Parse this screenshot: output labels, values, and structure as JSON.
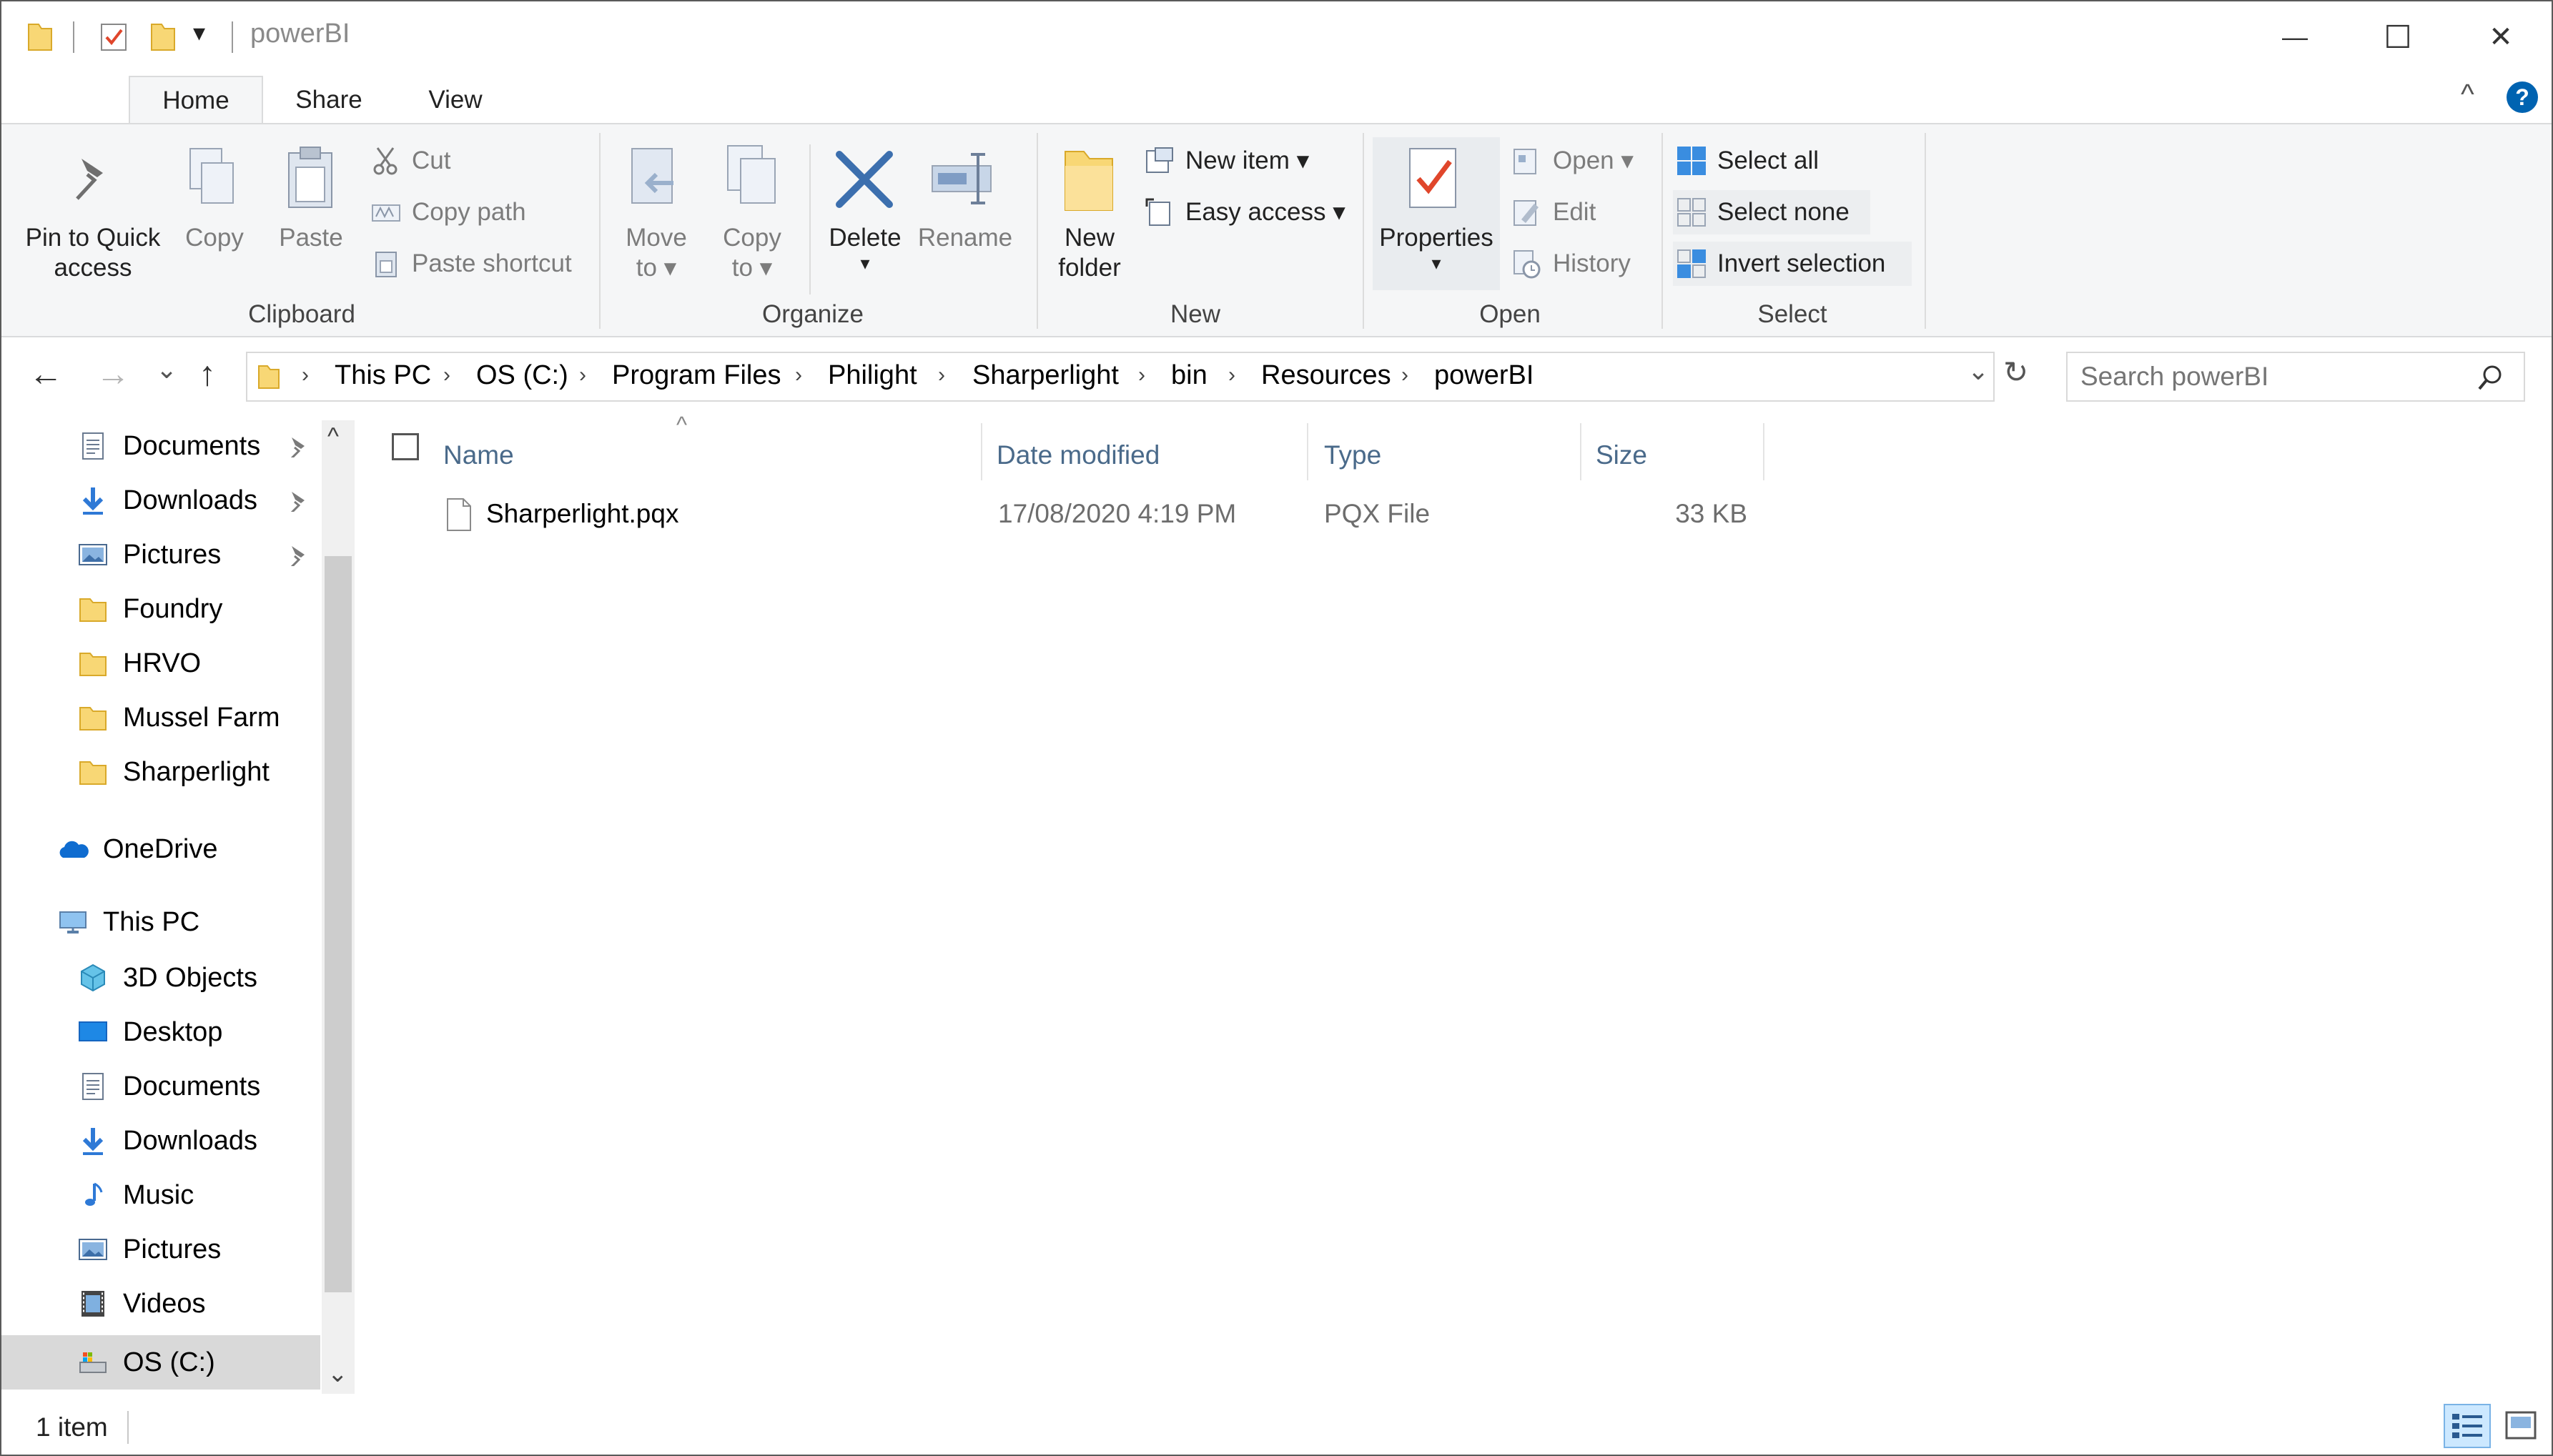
{
  "window": {
    "title": "powerBI",
    "minimize_glyph": "—",
    "maximize_glyph": "☐",
    "close_glyph": "✕"
  },
  "qat": {
    "customize_glyph": "▾"
  },
  "ribbon": {
    "tabs": [
      {
        "label": "Home",
        "active": true
      },
      {
        "label": "Share",
        "active": false
      },
      {
        "label": "View",
        "active": false
      }
    ],
    "collapse_glyph": "^",
    "help_glyph": "?",
    "clipboard": {
      "group_label": "Clipboard",
      "pin_label_1": "Pin to Quick",
      "pin_label_2": "access",
      "copy_label": "Copy",
      "paste_label": "Paste",
      "cut_label": "Cut",
      "copy_path_label": "Copy path",
      "paste_shortcut_label": "Paste shortcut"
    },
    "organize": {
      "group_label": "Organize",
      "move_to_1": "Move",
      "move_to_2": "to ▾",
      "copy_to_1": "Copy",
      "copy_to_2": "to ▾",
      "delete_label": "Delete",
      "delete_arrow": "▾",
      "rename_label": "Rename"
    },
    "new": {
      "group_label": "New",
      "new_folder_1": "New",
      "new_folder_2": "folder",
      "new_item_label": "New item ▾",
      "easy_access_label": "Easy access ▾"
    },
    "open": {
      "group_label": "Open",
      "properties_label": "Properties",
      "properties_arrow": "▾",
      "open_label": "Open ▾",
      "edit_label": "Edit",
      "history_label": "History"
    },
    "select": {
      "group_label": "Select",
      "select_all_label": "Select all",
      "select_none_label": "Select none",
      "invert_selection_label": "Invert selection"
    }
  },
  "address": {
    "back_glyph": "←",
    "forward_glyph": "→",
    "recent_glyph": "⌄",
    "up_glyph": "↑",
    "crumbs": [
      "This PC",
      "OS (C:)",
      "Program Files",
      "Philight",
      "Sharperlight",
      "bin",
      "Resources",
      "powerBI"
    ],
    "separator": "›",
    "dropdown_glyph": "⌄",
    "refresh_glyph": "↻",
    "search_placeholder": "Search powerBI"
  },
  "nav": {
    "quick_access": [
      {
        "label": "Documents",
        "icon": "documents-icon",
        "pinned": true
      },
      {
        "label": "Downloads",
        "icon": "downloads-icon",
        "pinned": true
      },
      {
        "label": "Pictures",
        "icon": "pictures-icon",
        "pinned": true
      },
      {
        "label": "Foundry",
        "icon": "folder-icon",
        "pinned": false
      },
      {
        "label": "HRVO",
        "icon": "folder-icon",
        "pinned": false
      },
      {
        "label": "Mussel Farm",
        "icon": "folder-icon",
        "pinned": false
      },
      {
        "label": "Sharperlight",
        "icon": "folder-icon",
        "pinned": false
      }
    ],
    "onedrive": "OneDrive",
    "this_pc": "This PC",
    "this_pc_items": [
      {
        "label": "3D Objects",
        "icon": "3d-objects-icon"
      },
      {
        "label": "Desktop",
        "icon": "desktop-icon"
      },
      {
        "label": "Documents",
        "icon": "documents-icon"
      },
      {
        "label": "Downloads",
        "icon": "downloads-icon"
      },
      {
        "label": "Music",
        "icon": "music-icon"
      },
      {
        "label": "Pictures",
        "icon": "pictures-icon"
      },
      {
        "label": "Videos",
        "icon": "videos-icon"
      },
      {
        "label": "OS (C:)",
        "icon": "drive-icon",
        "selected": true
      }
    ],
    "scroll_up_glyph": "^",
    "scroll_down_glyph": "⌄"
  },
  "files": {
    "columns": {
      "name": "Name",
      "date": "Date modified",
      "type": "Type",
      "size": "Size"
    },
    "sort_glyph": "^",
    "rows": [
      {
        "name": "Sharperlight.pqx",
        "date": "17/08/2020 4:19 PM",
        "type": "PQX File",
        "size": "33 KB"
      }
    ]
  },
  "status": {
    "count": "1 item"
  },
  "colors": {
    "ribbon_bg": "#f5f6f7",
    "accent_blue": "#0063b1",
    "folder_yellow": "#f8d775",
    "selected_bg": "#cce8ff"
  }
}
